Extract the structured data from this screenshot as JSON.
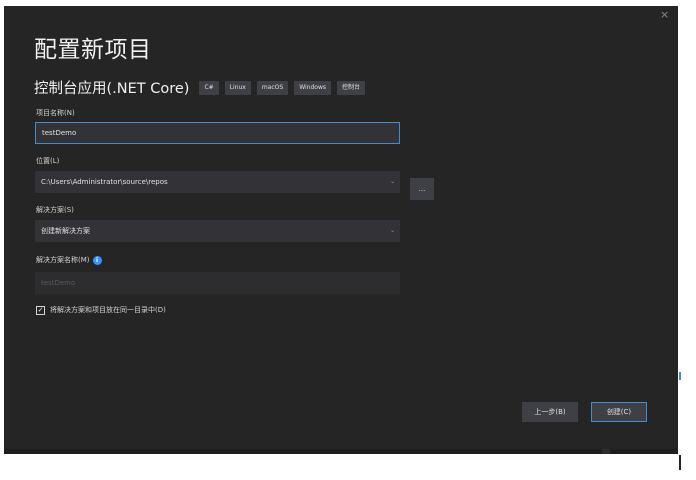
{
  "dialog": {
    "title": "配置新项目",
    "close_glyph": "×",
    "template_name": "控制台应用(.NET Core)",
    "tags": [
      "C#",
      "Linux",
      "macOS",
      "Windows",
      "控制台"
    ]
  },
  "project_name": {
    "label": "项目名称(N)",
    "value": "testDemo"
  },
  "location": {
    "label": "位置(L)",
    "value": "C:\\Users\\Administrator\\source\\repos",
    "browse_label": "..."
  },
  "solution": {
    "label": "解决方案(S)",
    "value": "创建新解决方案"
  },
  "solution_name": {
    "label": "解决方案名称(M)",
    "value": "testDemo",
    "info_glyph": "i"
  },
  "same_dir": {
    "label": "将解决方案和项目放在同一目录中(D)",
    "checked": true,
    "check_glyph": "✓"
  },
  "buttons": {
    "back": "上一步(B)",
    "create": "创建(C)"
  },
  "colors": {
    "dialog_bg": "#252526",
    "field_bg": "#333337",
    "accent": "#3e8ed0",
    "info": "#3794ff"
  }
}
